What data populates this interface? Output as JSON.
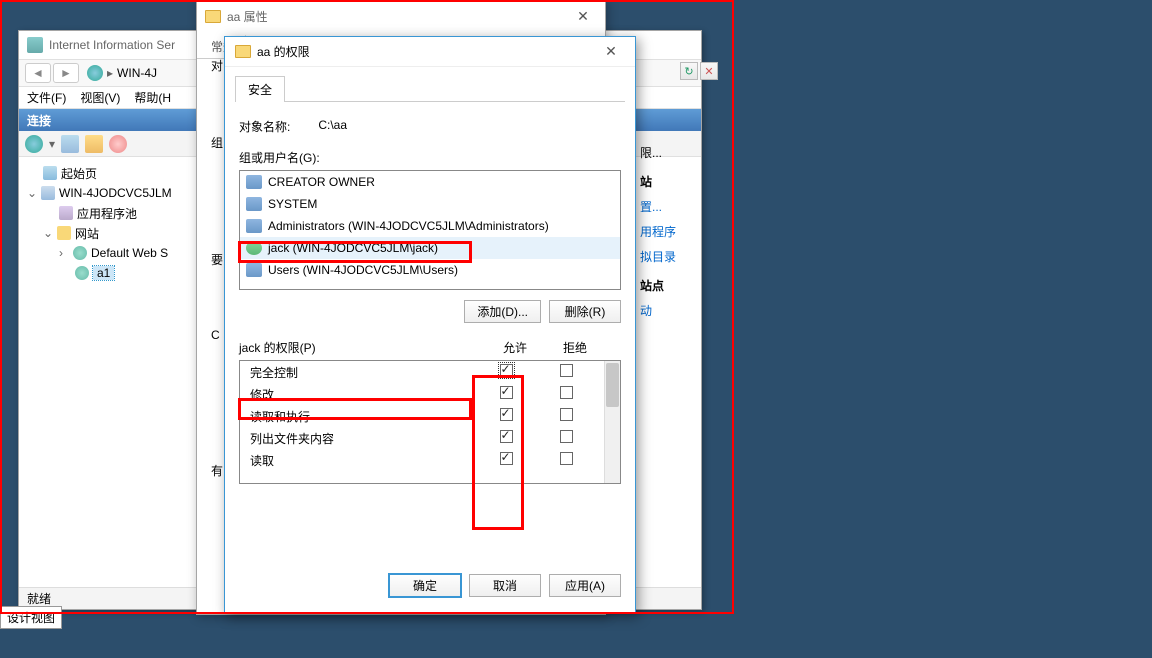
{
  "iis": {
    "title": "Internet Information Ser",
    "breadcrumb": "WIN-4J",
    "menu": {
      "file": "文件(F)",
      "view": "视图(V)",
      "help": "帮助(H"
    },
    "conn_header": "连接",
    "tree": {
      "start": "起始页",
      "server": "WIN-4JODCVC5JLM",
      "apppool": "应用程序池",
      "sites": "网站",
      "default_site": "Default Web S",
      "a1": "a1"
    },
    "status": "就绪"
  },
  "right_links": {
    "l1": "限...",
    "l2": "站",
    "l3": "置...",
    "l4": "用程序",
    "l5": "拟目录",
    "l6": "站点",
    "l7": "动"
  },
  "props": {
    "title": "aa 属性",
    "tabs": {
      "general": "常规"
    },
    "side": {
      "dui": "对",
      "zu": "组",
      "yao": "要",
      "ci": "C",
      "you": "有"
    }
  },
  "perm": {
    "title": "aa 的权限",
    "tabs": {
      "security": "安全"
    },
    "obj_label": "对象名称:",
    "obj_value": "C:\\aa",
    "group_label": "组或用户名(G):",
    "users": [
      {
        "name": "CREATOR OWNER",
        "type": "grp"
      },
      {
        "name": "SYSTEM",
        "type": "grp"
      },
      {
        "name": "Administrators (WIN-4JODCVC5JLM\\Administrators)",
        "type": "grp"
      },
      {
        "name": "jack (WIN-4JODCVC5JLM\\jack)",
        "type": "usr",
        "selected": true
      },
      {
        "name": "Users (WIN-4JODCVC5JLM\\Users)",
        "type": "grp"
      }
    ],
    "btn_add": "添加(D)...",
    "btn_remove": "删除(R)",
    "perm_for": "jack 的权限(P)",
    "col_allow": "允许",
    "col_deny": "拒绝",
    "perms": [
      {
        "label": "完全控制",
        "allow": true,
        "deny": false
      },
      {
        "label": "修改",
        "allow": true,
        "deny": false
      },
      {
        "label": "读取和执行",
        "allow": true,
        "deny": false
      },
      {
        "label": "列出文件夹内容",
        "allow": true,
        "deny": false
      },
      {
        "label": "读取",
        "allow": true,
        "deny": false
      }
    ],
    "btn_ok": "确定",
    "btn_cancel": "取消",
    "btn_apply": "应用(A)"
  },
  "designview": "设计视图"
}
